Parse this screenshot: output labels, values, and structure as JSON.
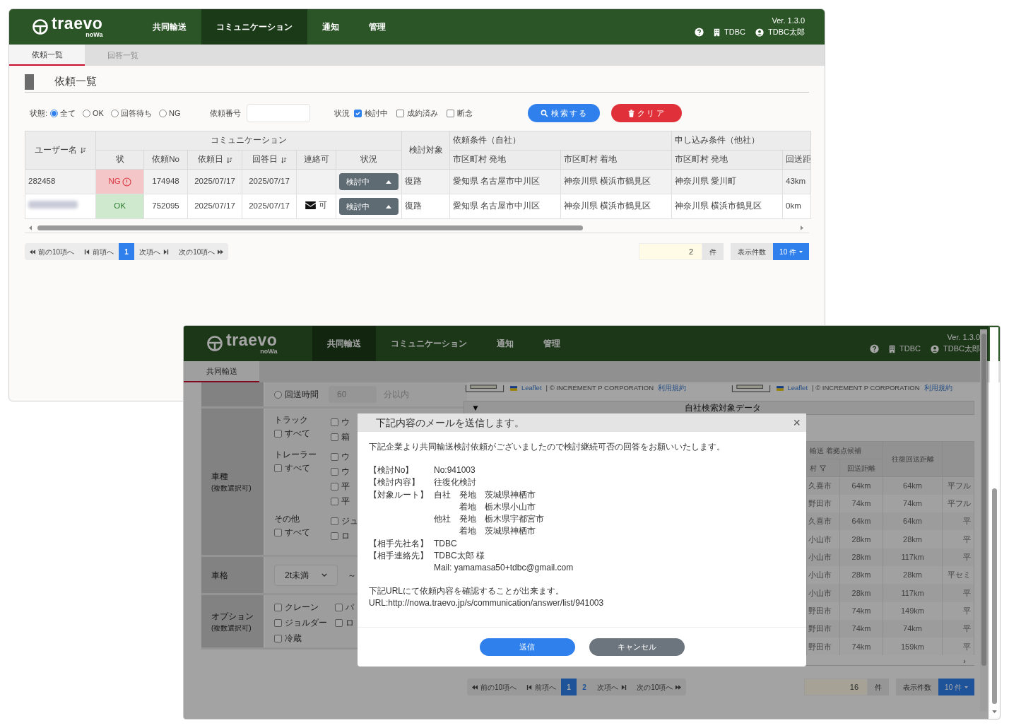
{
  "request_window": {
    "header": {
      "logo": "traevo",
      "logo_sub": "noWa",
      "nav": [
        {
          "label": "共同輸送",
          "selected": false
        },
        {
          "label": "コミュニケーション",
          "selected": true
        },
        {
          "label": "通知",
          "selected": false
        },
        {
          "label": "管理",
          "selected": false
        }
      ],
      "version": "Ver. 1.3.0",
      "org": "TDBC",
      "user": "TDBC太郎"
    },
    "tabs": [
      {
        "label": "依頼一覧",
        "selected": true,
        "disabled": false
      },
      {
        "label": "回答一覧",
        "selected": false,
        "disabled": true
      }
    ],
    "title": "依頼一覧",
    "filters": {
      "status_label": "状態:",
      "status_options": [
        {
          "label": "全て",
          "selected": true
        },
        {
          "label": "OK",
          "selected": false
        },
        {
          "label": "回答待ち",
          "selected": false
        },
        {
          "label": "NG",
          "selected": false
        }
      ],
      "number_label": "依頼番号",
      "condition_label": "状況",
      "condition_options": [
        {
          "label": "検討中",
          "checked": true
        },
        {
          "label": "成約済み",
          "checked": false
        },
        {
          "label": "断念",
          "checked": false
        }
      ],
      "search_button": "検索する",
      "clear_button": "クリア"
    },
    "table": {
      "user_column": {
        "label": "ユーザー名",
        "sortable": true
      },
      "group_communication": "コミュニケーション",
      "target_column": "検討対象",
      "group_own": "依頼条件（自社）",
      "group_other": "申し込み条件（他社）",
      "columns": [
        {
          "label": "状",
          "sortable": false
        },
        {
          "label": "依頼No",
          "sortable": false
        },
        {
          "label": "依頼日",
          "sortable": true
        },
        {
          "label": "回答日",
          "sortable": true
        },
        {
          "label": "連絡可",
          "sortable": false
        },
        {
          "label": "状況",
          "sortable": false
        }
      ],
      "own_columns": [
        "市区町村 発地",
        "市区町村 着地"
      ],
      "other_columns": [
        "市区町村 発地",
        "回送距"
      ],
      "rows": [
        {
          "user": "282458",
          "user_blurred": false,
          "reply": {
            "label": "NG",
            "kind": "ng"
          },
          "number": "174948",
          "request_date": "2025/07/17",
          "answer_date": "2025/07/17",
          "status": "検討中",
          "target": "復路",
          "own_from": "愛知県 名古屋市中川区",
          "own_to": "神奈川県 横浜市鶴見区",
          "other_from": "神奈川県 愛川町",
          "distance": "43km"
        },
        {
          "user_blurred": true,
          "reply": {
            "label": "OK",
            "kind": "ok"
          },
          "number": "752095",
          "request_date": "2025/07/17",
          "answer_date": "2025/07/17",
          "contact": "可",
          "status": "検討中",
          "target": "復路",
          "own_from": "愛知県 名古屋市中川区",
          "own_to": "神奈川県 横浜市鶴見区",
          "other_from": "神奈川県 横浜市鶴見区",
          "distance": "0km"
        }
      ]
    },
    "pagination": {
      "first": "前の10項へ",
      "prev": "前項へ",
      "pages": [
        {
          "label": "1",
          "selected": true
        }
      ],
      "next": "次項へ",
      "next10": "次の10項へ",
      "count": "2",
      "unit": "件",
      "per_page_label": "表示件数",
      "per_page": "10 件"
    }
  },
  "transport_window": {
    "header": {
      "logo": "traevo",
      "logo_sub": "noWa",
      "nav": [
        {
          "label": "共同輸送",
          "selected": true
        },
        {
          "label": "コミュニケーション",
          "selected": false
        },
        {
          "label": "通知",
          "selected": false
        },
        {
          "label": "管理",
          "selected": false
        }
      ],
      "version": "Ver. 1.3.0",
      "org": "TDBC",
      "user": "TDBC太郎"
    },
    "tabs": [
      {
        "label": "共同輸送",
        "selected": true
      }
    ],
    "form": {
      "return_time": {
        "label": "回送時間",
        "selected": false,
        "value": "60",
        "unit": "分以内"
      },
      "vehicle": {
        "label": "車種",
        "note": "(複数選択可)",
        "groups": [
          {
            "label": "トラック",
            "all": {
              "label": "すべて",
              "checked": false
            },
            "options": [
              {
                "label": "ウ",
                "checked": false
              },
              {
                "label": "箱",
                "checked": false
              }
            ]
          },
          {
            "label": "トレーラー",
            "all": {
              "label": "すべて",
              "checked": false
            },
            "options": [
              {
                "label": "ウ",
                "checked": false
              },
              {
                "label": "ウ",
                "checked": false
              },
              {
                "label": "平",
                "checked": false
              },
              {
                "label": "平",
                "checked": false
              }
            ]
          },
          {
            "label": "その他",
            "all": {
              "label": "すべて",
              "checked": false
            },
            "options": [
              {
                "label": "ジュ",
                "checked": false
              },
              {
                "label": "ロ",
                "checked": false
              }
            ]
          }
        ]
      },
      "size": {
        "label": "車格",
        "value": "2t未満",
        "tilde": "～"
      },
      "options": {
        "label": "オプション",
        "note": "(複数選択可)",
        "items": [
          {
            "label": "クレーン",
            "checked": false
          },
          {
            "label": "パ",
            "checked": false
          },
          {
            "label": "ジョルダー",
            "checked": false
          },
          {
            "label": "ロ",
            "checked": false
          },
          {
            "label": "冷蔵",
            "checked": false
          }
        ]
      }
    },
    "map_attributions": [
      {
        "link": "Leaflet",
        "text": "| © INCREMENT P CORPORATION",
        "terms": "利用規約"
      },
      {
        "link": "Leaflet",
        "text": "| © INCREMENT P CORPORATION",
        "terms": "利用規約"
      }
    ],
    "data_strip": {
      "toggle": "▼",
      "title": "自社検索対象データ"
    },
    "results": {
      "group": "輸送 着拠点候補",
      "round_trip": "往復回送距離",
      "sub_columns": [
        "村",
        "回送距離"
      ],
      "scroll_arrow": "›",
      "rows": [
        [
          "久喜市",
          "64km",
          "64km",
          "平フル"
        ],
        [
          "野田市",
          "74km",
          "74km",
          "平フル"
        ],
        [
          "久喜市",
          "64km",
          "64km",
          "平"
        ],
        [
          "小山市",
          "28km",
          "28km",
          "平"
        ],
        [
          "小山市",
          "28km",
          "117km",
          "平"
        ],
        [
          "小山市",
          "28km",
          "28km",
          "平セミ"
        ],
        [
          "小山市",
          "28km",
          "117km",
          "平"
        ],
        [
          "野田市",
          "74km",
          "149km",
          "平"
        ],
        [
          "野田市",
          "74km",
          "74km",
          "平"
        ],
        [
          "野田市",
          "74km",
          "159km",
          "平"
        ]
      ]
    },
    "pagination": {
      "first": "前の10項へ",
      "prev": "前項へ",
      "pages": [
        {
          "label": "1",
          "selected": true
        },
        {
          "label": "2",
          "selected": false
        }
      ],
      "next": "次項へ",
      "next10": "次の10項へ",
      "count": "16",
      "unit": "件",
      "per_page_label": "表示件数",
      "per_page": "10 件"
    },
    "dialog": {
      "title": "下記内容のメールを送信します。",
      "close": "×",
      "intro": "下記企業より共同輸送検討依頼がございましたので検討継続可否の回答をお願いいたします。",
      "fields": [
        {
          "kind": "text",
          "label": "【検討No】",
          "lines": [
            "No:941003"
          ]
        },
        {
          "kind": "text",
          "label": "【検討内容】",
          "lines": [
            "往復化検討"
          ]
        },
        {
          "kind": "route",
          "label": "【対象ルート】",
          "routes": [
            {
              "party": "自社",
              "legs": [
                {
                  "point": "発地",
                  "place": "茨城県神栖市"
                },
                {
                  "point": "着地",
                  "place": "栃木県小山市"
                }
              ]
            },
            {
              "party": "他社",
              "legs": [
                {
                  "point": "発地",
                  "place": "栃木県宇都宮市"
                },
                {
                  "point": "着地",
                  "place": "茨城県神栖市"
                }
              ]
            }
          ]
        },
        {
          "kind": "text",
          "label": "【相手先社名】",
          "lines": [
            "TDBC"
          ]
        },
        {
          "kind": "text",
          "label": "【相手連絡先】",
          "lines": [
            "TDBC太郎 様",
            "Mail: yamamasa50+tdbc@gmail.com"
          ]
        }
      ],
      "footer": [
        "下記URLにて依頼内容を確認することが出来ます。",
        "URL:http://nowa.traevo.jp/s/communication/answer/list/941003"
      ],
      "send": "送信",
      "cancel": "キャンセル"
    }
  }
}
